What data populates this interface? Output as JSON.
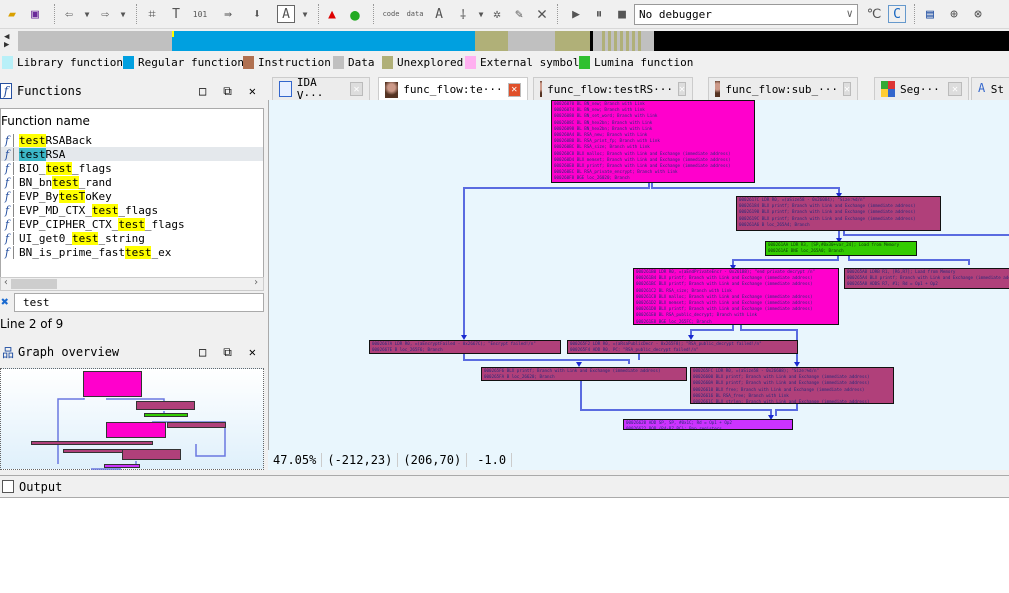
{
  "toolbar": {
    "debugger_select": "No debugger"
  },
  "legend": [
    {
      "label": "Library function",
      "color": "#b8f0f8"
    },
    {
      "label": "Regular function",
      "color": "#00a0e0"
    },
    {
      "label": "Instruction",
      "color": "#b07050"
    },
    {
      "label": "Data",
      "color": "#c0c0c0"
    },
    {
      "label": "Unexplored",
      "color": "#b0b078"
    },
    {
      "label": "External symbol",
      "color": "#ffb0f0"
    },
    {
      "label": "Lumina function",
      "color": "#30c030"
    }
  ],
  "tabs": [
    {
      "label": "IDA V···",
      "icon": "ida-view-icon",
      "active": false
    },
    {
      "label": "func_flow:te···",
      "icon": "func-flow-icon",
      "active": true
    },
    {
      "label": "func_flow:testRS···",
      "icon": "func-flow-icon",
      "active": false
    },
    {
      "label": "func_flow:sub_···",
      "icon": "func-flow-icon",
      "active": false
    },
    {
      "label": "Seg···",
      "icon": "segments-icon",
      "active": false
    },
    {
      "label": "St",
      "icon": "strings-icon",
      "active": false
    }
  ],
  "functions_panel": {
    "title": "Functions",
    "column_header": "Function name",
    "items": [
      {
        "pre": "",
        "match": "test",
        "post": "RSABack"
      },
      {
        "pre": "",
        "match": "test",
        "post": "RSA"
      },
      {
        "pre": "BIO_",
        "match": "test",
        "post": "_flags"
      },
      {
        "pre": "BN_bn",
        "match": "test",
        "post": "_rand"
      },
      {
        "pre": "EVP_By",
        "match": "tesT",
        "post": "oKey"
      },
      {
        "pre": "EVP_MD_CTX_",
        "match": "test",
        "post": "_flags"
      },
      {
        "pre": "EVP_CIPHER_CTX_",
        "match": "test",
        "post": "_flags"
      },
      {
        "pre": "UI_get0_",
        "match": "test",
        "post": "_string"
      },
      {
        "pre": "BN_is_prime_fast",
        "match": "test",
        "post": "_ex"
      }
    ],
    "selected_index": 1,
    "filter_value": "test",
    "line_status": "Line 2 of 9"
  },
  "graph_overview": {
    "title": "Graph overview"
  },
  "graph": {
    "nodes": [
      {
        "lines": [
          "00026070 BL  BN_new; Branch with Link",
          "00026074 BL  BN_new; Branch with Link",
          "00026080 BL  BN_set_word; Branch with Link",
          "0002608C BL  BN_hex2bn; Branch with Link",
          "00026098 BL  BN_hex2bn; Branch with Link",
          "000260A4 BL  RSA_new; Branch with Link",
          "000260B0 BL  RSA_print_fp; Branch with Link",
          "000260BC BL  RSA_size; Branch with Link",
          "000260C8 BLX  malloc; Branch with Link and Exchange (immediate address)",
          "000260D4 BLX  memset; Branch with Link and Exchange (immediate address)",
          "000260E0 BLX  printf; Branch with Link and Exchange (immediate address)",
          "000260EC BL  RSA_private_encrypt; Branch with Link",
          "000260F8 BGE  loc_26020; Branch"
        ]
      },
      {
        "lines": [
          "0002617C LDR  R0, =(aSize58 - 0x26084); \"Size:%d/n\"",
          "00026184 BLX  printf; Branch with Link and Exchange (immediate address)",
          "00026190 BLX  printf; Branch with Link and Exchange (immediate address)",
          "0002619C BLX  printf; Branch with Link and Exchange (immediate address)",
          "000261A6 B  loc_265A4; Branch"
        ]
      },
      {
        "lines": [
          "000261AA LDR  R3, [SP,#0x30+var_24]; Load from Memory",
          "000261AE BNE  loc_265A0; Branch"
        ]
      },
      {
        "lines": [
          "000261B0 LDR  R0, =(aEndPrivateEncr - 0x261B8); \"end private decrypt /n\"",
          "000261B4 BLX  printf; Branch with Link and Exchange (immediate address)",
          "000261BC BLX  printf; Branch with Link and Exchange (immediate address)",
          "000261C2 BL  RSA_size; Branch with Link",
          "000261C8 BLX  malloc; Branch with Link and Exchange (immediate address)",
          "000261D2 BLX  memset; Branch with Link and Exchange (immediate address)",
          "000261D8 BLX  printf; Branch with Link and Exchange (immediate address)",
          "000261E0 BL  RSA_public_decrypt; Branch with Link",
          "000261E8 BGE  loc_265FC; Branch"
        ]
      },
      {
        "lines": [
          "000265A0 LDRB  R1, [R6,R7]; Load from Memory",
          "000265A4 BLX  printf; Branch with Link and Exchange (immediate address)",
          "000265A8 ADDS  R7, #1; Rd = Op1 + Op2"
        ]
      },
      {
        "lines": [
          "0002667A LDR  R0, =(aEncryptFailed - 0x2667C); \"Encrypt failed!/n\"",
          "0002667E B  loc_265F6; Branch"
        ]
      },
      {
        "lines": [
          "000265F2 LDR  R0, =(aRsaPublicDecr - 0x265F8); \"RSA_public_decrypt failed!/n\"",
          "000265F4 ADD  R0, PC; \"RSA_public_decrypt failed!/n\""
        ]
      },
      {
        "lines": [
          "000265F6 BLX  printf; Branch with Link and Exchange (immediate address)",
          "000265FA B  loc_26620; Branch"
        ]
      },
      {
        "lines": [
          "000265FC LDR  R0, =(aSize58 - 0x26608); \"Size:%d/n\"",
          "00026600 BLX  printf; Branch with Link and Exchange (immediate address)",
          "0002660A BLX  printf; Branch with Link and Exchange (immediate address)",
          "00026610 BLX  free; Branch with Link and Exchange (immediate address)",
          "00026616 BL  RSA_free; Branch with Link",
          "0002661C BLX  strlen; Branch with Link and Exchange (immediate address)"
        ]
      },
      {
        "lines": [
          "00026620 ADD  SP, SP, #0x1C; Rd = Op1 + Op2",
          "00026622 POP  {R4-R7,PC}; Pop registers"
        ]
      }
    ]
  },
  "statusbar": {
    "zoom": "47.05%",
    "cursor": "(-212,23)",
    "position": "(206,70)",
    "value": "-1.0"
  },
  "output_panel": {
    "title": "Output"
  }
}
